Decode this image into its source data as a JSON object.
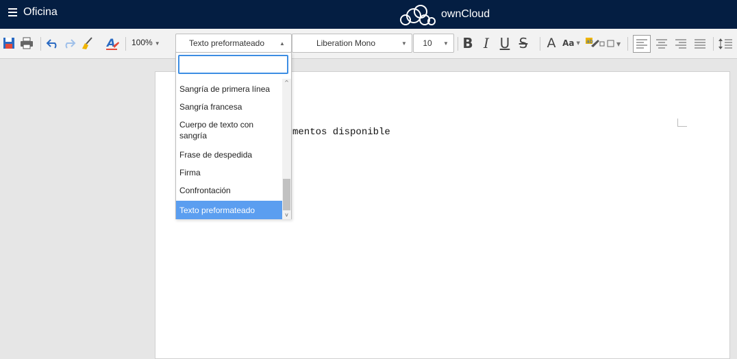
{
  "header": {
    "app_title": "Oficina",
    "brand_name": "ownCloud",
    "bg_color": "#041e42"
  },
  "toolbar": {
    "zoom_value": "100%",
    "paragraph_style": "Texto preformateado",
    "font_name": "Liberation Mono",
    "font_size": "10",
    "icons": [
      "save-icon",
      "print-icon",
      "undo-icon",
      "redo-icon",
      "clear-formatting-icon",
      "paint-format-icon",
      "bold-icon",
      "italic-icon",
      "underline-icon",
      "strikethrough-icon",
      "grow-font-icon",
      "change-case-icon",
      "highlight-color-icon",
      "font-color-icon",
      "align-left-icon",
      "align-center-icon",
      "align-right-icon",
      "justify-icon",
      "line-spacing-icon"
    ]
  },
  "style_dropdown": {
    "search_value": "",
    "items": [
      {
        "label": "Sangría de primera línea"
      },
      {
        "label": "Sangría francesa"
      },
      {
        "label": "Cuerpo de texto con sangría"
      },
      {
        "label": "Frase de despedida"
      },
      {
        "label": "Firma"
      },
      {
        "label": "Confrontación"
      },
      {
        "label": "Texto preformateado",
        "selected": true
      }
    ],
    "selected_color": "#5b9ef0"
  },
  "document": {
    "visible_text": "mentos disponible"
  }
}
